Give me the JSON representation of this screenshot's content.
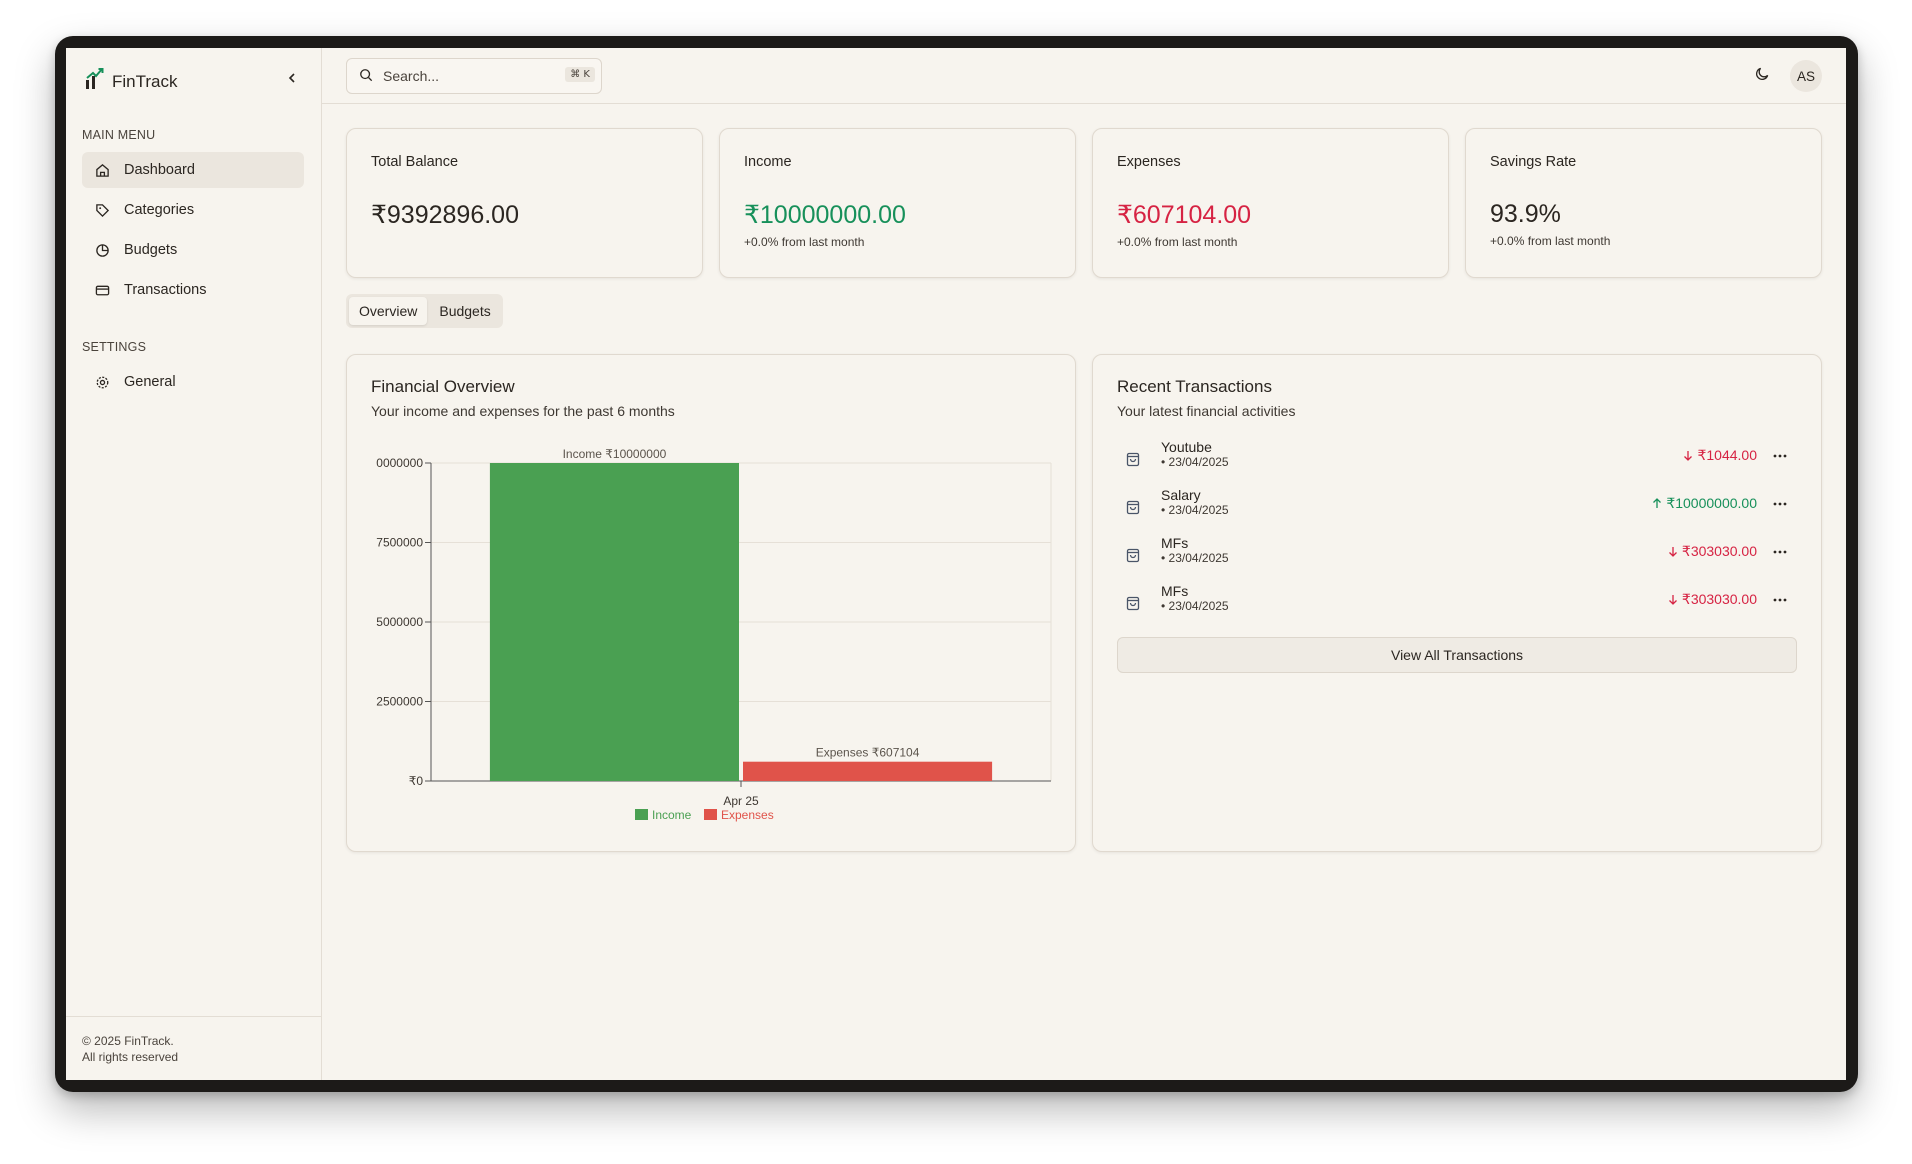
{
  "app": {
    "name": "FinTrack"
  },
  "sidebar": {
    "main_menu_label": "MAIN MENU",
    "items": [
      {
        "label": "Dashboard",
        "icon": "home-icon"
      },
      {
        "label": "Categories",
        "icon": "tag-icon"
      },
      {
        "label": "Budgets",
        "icon": "pie-chart-icon"
      },
      {
        "label": "Transactions",
        "icon": "credit-card-icon"
      }
    ],
    "settings_label": "SETTINGS",
    "settings_items": [
      {
        "label": "General",
        "icon": "gear-icon"
      }
    ],
    "footer_line1": "© 2025 FinTrack.",
    "footer_line2": "All rights reserved"
  },
  "header": {
    "search_placeholder": "Search...",
    "shortcut": "⌘ K",
    "avatar_initials": "AS"
  },
  "stats": [
    {
      "title": "Total Balance",
      "value": "₹9392896.00",
      "sub": ""
    },
    {
      "title": "Income",
      "value": "₹10000000.00",
      "sub": "+0.0% from last month"
    },
    {
      "title": "Expenses",
      "value": "₹607104.00",
      "sub": "+0.0% from last month"
    },
    {
      "title": "Savings Rate",
      "value": "93.9%",
      "sub": "+0.0% from last month"
    }
  ],
  "tabs": [
    {
      "label": "Overview"
    },
    {
      "label": "Budgets"
    }
  ],
  "overview": {
    "title": "Financial Overview",
    "description": "Your income and expenses for the past 6 months"
  },
  "chart_data": {
    "type": "bar",
    "categories": [
      "Apr 25"
    ],
    "series": [
      {
        "name": "Income",
        "values": [
          10000000
        ],
        "label": "Income ₹10000000",
        "color": "#4aa052"
      },
      {
        "name": "Expenses",
        "values": [
          607104
        ],
        "label": "Expenses ₹607104",
        "color": "#e0534a"
      }
    ],
    "yticks": [
      "₹0",
      "2500000",
      "5000000",
      "7500000",
      "0000000"
    ],
    "ylim": [
      0,
      10000000
    ],
    "grid": true,
    "legend": "bottom-center"
  },
  "transactions": {
    "title": "Recent Transactions",
    "description": "Your latest financial activities",
    "items": [
      {
        "name": "Youtube",
        "date": "• 23/04/2025",
        "amount": "₹1044.00",
        "direction": "down"
      },
      {
        "name": "Salary",
        "date": "• 23/04/2025",
        "amount": "₹10000000.00",
        "direction": "up"
      },
      {
        "name": "MFs",
        "date": "• 23/04/2025",
        "amount": "₹303030.00",
        "direction": "down"
      },
      {
        "name": "MFs",
        "date": "• 23/04/2025",
        "amount": "₹303030.00",
        "direction": "down"
      }
    ],
    "view_all_label": "View All Transactions"
  },
  "colors": {
    "income": "#4aa052",
    "expenses": "#e0534a",
    "positive_text": "#17905a",
    "negative_text": "#d62343",
    "background": "#f7f4ee"
  }
}
